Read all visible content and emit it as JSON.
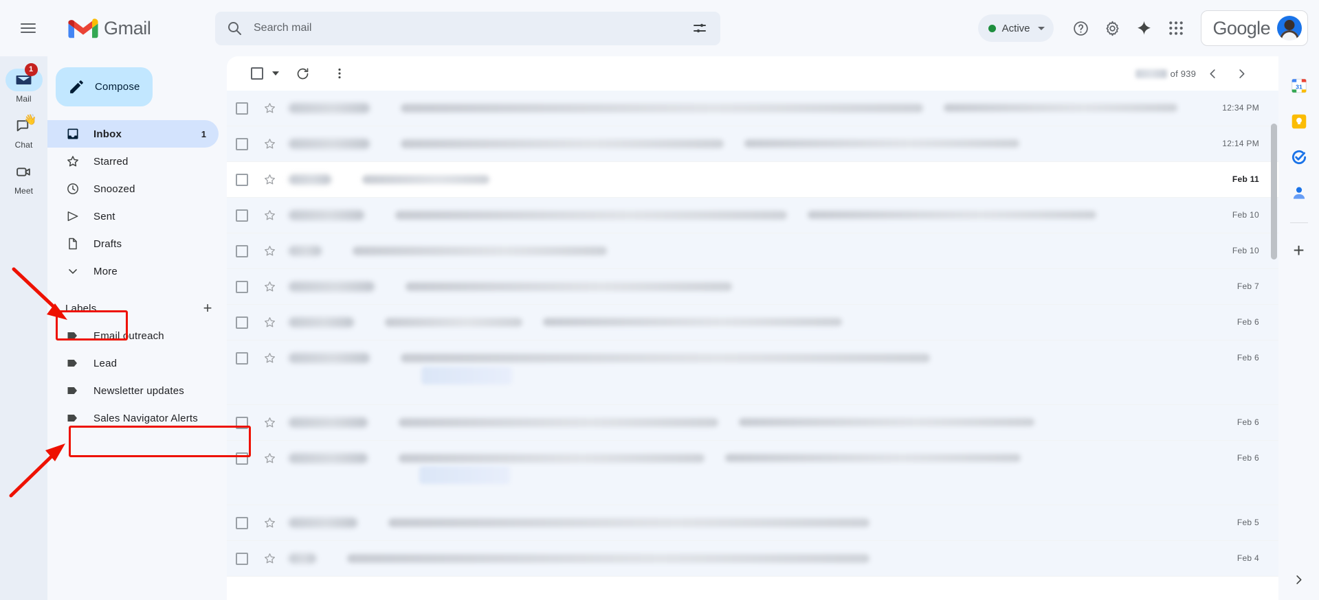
{
  "header": {
    "menu_icon": "hamburger-menu-icon",
    "brand": "Gmail",
    "brand_logo_icon": "gmail-m-logo-icon",
    "search": {
      "placeholder": "Search mail",
      "value": "",
      "search_icon": "search-icon",
      "options_icon": "search-options-icon"
    },
    "status": {
      "label": "Active",
      "dot_color": "#1e8e3e",
      "chevron_icon": "chevron-down-icon"
    },
    "help_icon": "help-question-icon",
    "settings_icon": "gear-icon",
    "gemini_icon": "gemini-sparkle-icon",
    "apps_icon": "google-apps-grid-icon",
    "account": {
      "word": "Google",
      "avatar_icon": "user-avatar"
    }
  },
  "app_rail": [
    {
      "label": "Mail",
      "icon": "mail-envelope-icon",
      "badge": "1",
      "active": true
    },
    {
      "label": "Chat",
      "icon": "chat-bubble-icon",
      "badge": "",
      "active": false,
      "emoji": "👋"
    },
    {
      "label": "Meet",
      "icon": "meet-camera-icon",
      "badge": "",
      "active": false
    }
  ],
  "sidebar": {
    "compose": {
      "label": "Compose",
      "icon": "pencil-compose-icon"
    },
    "nav": [
      {
        "label": "Inbox",
        "icon": "inbox-icon",
        "count": "1",
        "active": true
      },
      {
        "label": "Starred",
        "icon": "star-icon",
        "count": "",
        "active": false
      },
      {
        "label": "Snoozed",
        "icon": "clock-icon",
        "count": "",
        "active": false
      },
      {
        "label": "Sent",
        "icon": "send-icon",
        "count": "",
        "active": false
      },
      {
        "label": "Drafts",
        "icon": "draft-icon",
        "count": "",
        "active": false
      },
      {
        "label": "More",
        "icon": "chevron-down-icon",
        "count": "",
        "active": false
      }
    ],
    "labels_header": {
      "title": "Labels",
      "add_icon": "plus-icon"
    },
    "labels": [
      {
        "label": "Email outreach",
        "icon": "label-tag-icon"
      },
      {
        "label": "Lead",
        "icon": "label-tag-icon"
      },
      {
        "label": "Newsletter updates",
        "icon": "label-tag-icon"
      },
      {
        "label": "Sales Navigator Alerts",
        "icon": "label-tag-icon",
        "highlighted": true
      }
    ],
    "annotation_color": "#ee1100"
  },
  "list_toolbar": {
    "select_all_icon": "checkbox-icon",
    "select_caret_icon": "chevron-down-icon",
    "refresh_icon": "refresh-icon",
    "more_icon": "more-vertical-icon",
    "pagination": {
      "count_redacted": "",
      "of_text": "of 939",
      "prev_icon": "chevron-left-icon",
      "next_icon": "chevron-right-icon"
    }
  },
  "mail_rows": [
    {
      "date": "12:34 PM",
      "unread": false,
      "bold_date": false,
      "tall": false,
      "sender_w": 118,
      "subj_w": 760,
      "snippet_w": 340,
      "attachment": false
    },
    {
      "date": "12:14 PM",
      "unread": false,
      "bold_date": false,
      "tall": false,
      "sender_w": 118,
      "subj_w": 470,
      "snippet_w": 400,
      "attachment": false
    },
    {
      "date": "Feb 11",
      "unread": true,
      "bold_date": true,
      "tall": false,
      "sender_w": 62,
      "subj_w": 185,
      "snippet_w": 0,
      "attachment": false
    },
    {
      "date": "Feb 10",
      "unread": false,
      "bold_date": false,
      "tall": false,
      "sender_w": 110,
      "subj_w": 570,
      "snippet_w": 420,
      "attachment": false
    },
    {
      "date": "Feb 10",
      "unread": false,
      "bold_date": false,
      "tall": false,
      "sender_w": 48,
      "subj_w": 370,
      "snippet_w": 0,
      "attachment": false
    },
    {
      "date": "Feb 7",
      "unread": false,
      "bold_date": false,
      "tall": false,
      "sender_w": 125,
      "subj_w": 475,
      "snippet_w": 0,
      "attachment": false
    },
    {
      "date": "Feb 6",
      "unread": false,
      "bold_date": false,
      "tall": false,
      "sender_w": 95,
      "subj_w": 200,
      "snippet_w": 435,
      "attachment": false
    },
    {
      "date": "Feb 6",
      "unread": false,
      "bold_date": false,
      "tall": true,
      "sender_w": 118,
      "subj_w": 770,
      "snippet_w": 0,
      "attachment": true
    },
    {
      "date": "Feb 6",
      "unread": false,
      "bold_date": false,
      "tall": false,
      "sender_w": 115,
      "subj_w": 465,
      "snippet_w": 430,
      "attachment": false
    },
    {
      "date": "Feb 6",
      "unread": false,
      "bold_date": false,
      "tall": true,
      "sender_w": 115,
      "subj_w": 445,
      "snippet_w": 430,
      "attachment": true
    },
    {
      "date": "Feb 5",
      "unread": false,
      "bold_date": false,
      "tall": false,
      "sender_w": 100,
      "subj_w": 700,
      "snippet_w": 0,
      "attachment": false
    },
    {
      "date": "Feb 4",
      "unread": false,
      "bold_date": false,
      "tall": false,
      "sender_w": 40,
      "subj_w": 760,
      "snippet_w": 0,
      "attachment": false
    }
  ],
  "side_rail": [
    {
      "icon": "google-calendar-icon"
    },
    {
      "icon": "google-keep-icon"
    },
    {
      "icon": "google-tasks-icon"
    },
    {
      "icon": "google-contacts-icon"
    }
  ],
  "side_rail_add": {
    "icon": "plus-icon"
  },
  "side_rail_expand": {
    "icon": "chevron-right-icon"
  }
}
